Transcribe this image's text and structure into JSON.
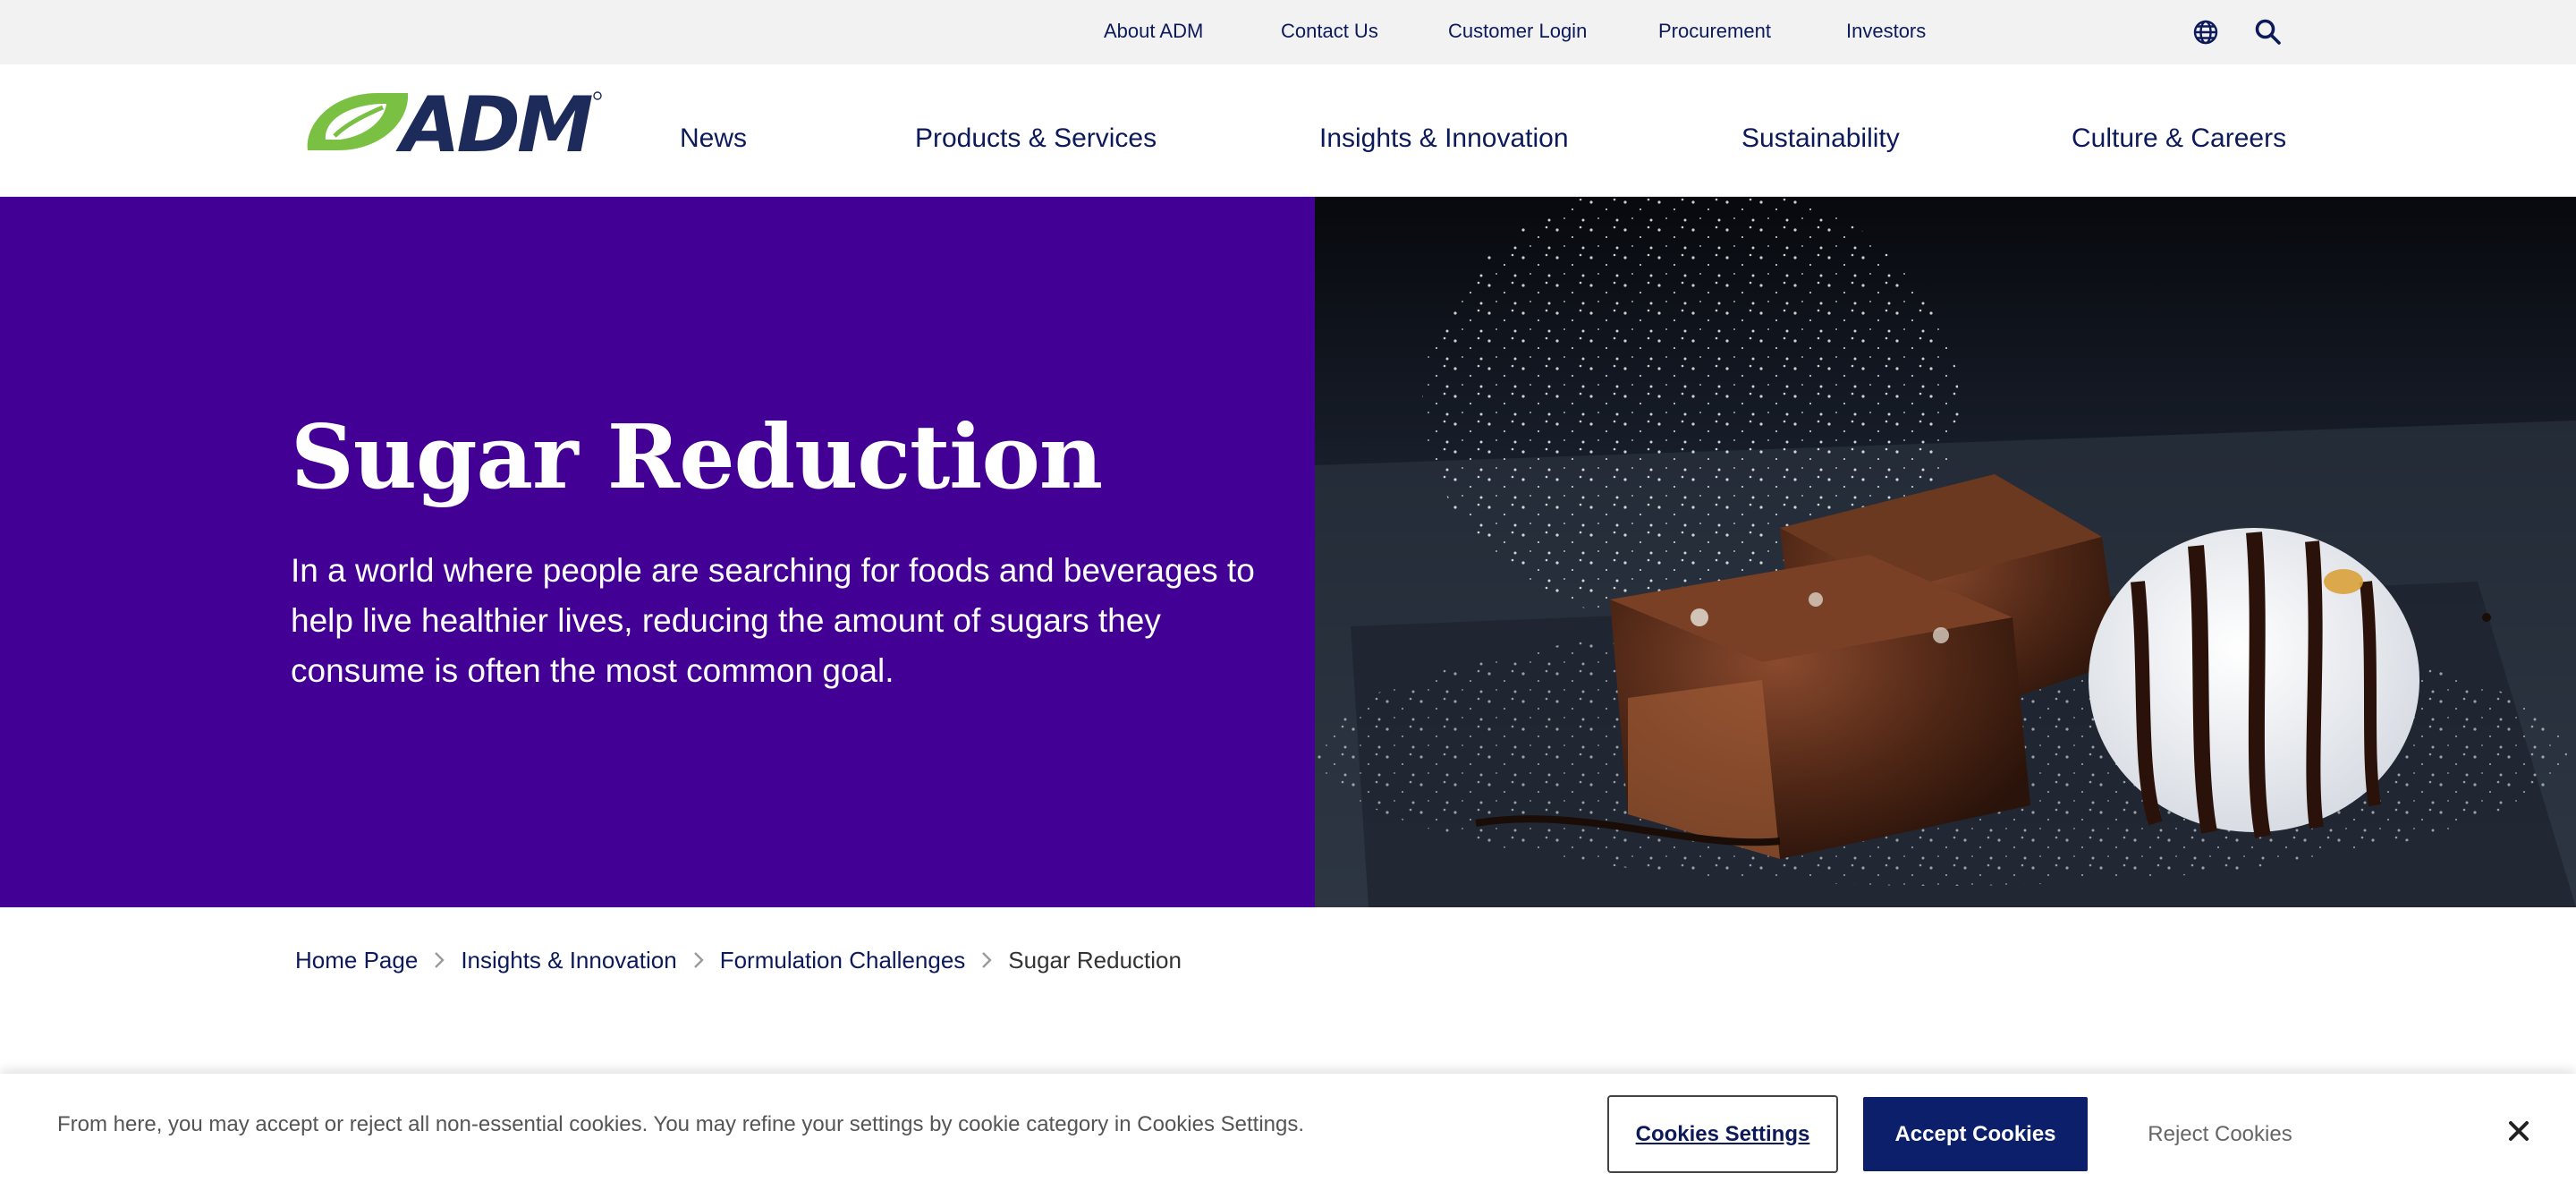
{
  "utility_nav": {
    "links": [
      "About ADM",
      "Contact Us",
      "Customer Login",
      "Procurement",
      "Investors"
    ],
    "icons": [
      "globe-icon",
      "search-icon"
    ]
  },
  "brand": {
    "logo_text": "ADM",
    "colors": {
      "leaf_green": "#7ac143",
      "navy": "#1c2b5a"
    }
  },
  "main_nav": {
    "items": [
      "News",
      "Products & Services",
      "Insights & Innovation",
      "Sustainability",
      "Culture & Careers"
    ]
  },
  "hero": {
    "title": "Sugar Reduction",
    "description": "In a world where people are searching for foods and beverages to help live healthier lives, reducing the amount of sugars they consume is often the most common goal.",
    "background_color": "#430095",
    "image_subject": "brownies with powdered sugar and ice cream drizzled with chocolate"
  },
  "breadcrumb": {
    "items": [
      "Home Page",
      "Insights & Innovation",
      "Formulation Challenges"
    ],
    "current": "Sugar Reduction",
    "separator_icon": "chevron-right-icon"
  },
  "cookie_banner": {
    "text": "From here, you may accept or reject all non-essential cookies. You may refine your settings by cookie category in Cookies Settings.",
    "settings_label": "Cookies Settings",
    "accept_label": "Accept Cookies",
    "reject_label": "Reject Cookies",
    "close_icon": "close-icon"
  }
}
